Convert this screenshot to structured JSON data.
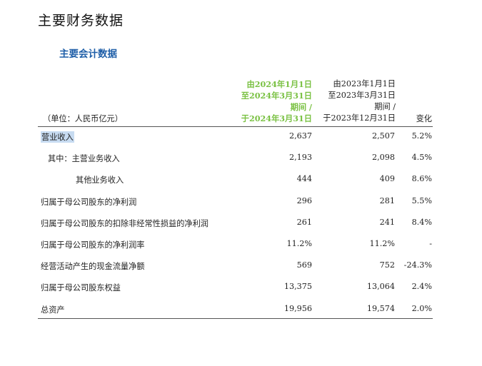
{
  "page_title": "主要财务数据",
  "section_title": "主要会计数据",
  "unit_label": "（单位：人民币亿元）",
  "columns": {
    "current": [
      "由2024年1月1日",
      "至2024年3月31日",
      "期间 /",
      "于2024年3月31日"
    ],
    "prior": [
      "由2023年1月1日",
      "至2023年3月31日",
      "期间 /",
      "于2023年12月31日"
    ],
    "change": "变化"
  },
  "rows": [
    {
      "label": "营业收入",
      "current": "2,637",
      "prior": "2,507",
      "change": "5.2%"
    },
    {
      "label": "其中：主营业务收入",
      "current": "2,193",
      "prior": "2,098",
      "change": "4.5%"
    },
    {
      "label": "其他业务收入",
      "current": "444",
      "prior": "409",
      "change": "8.6%"
    },
    {
      "label": "归属于母公司股东的净利润",
      "current": "296",
      "prior": "281",
      "change": "5.5%"
    },
    {
      "label": "归属于母公司股东的扣除非经常性损益的净利润",
      "current": "261",
      "prior": "241",
      "change": "8.4%"
    },
    {
      "label": "归属于母公司股东的净利润率",
      "current": "11.2%",
      "prior": "11.2%",
      "change": "-"
    },
    {
      "label": "经营活动产生的现金流量净额",
      "current": "569",
      "prior": "752",
      "change": "-24.3%"
    },
    {
      "label": "归属于母公司股东权益",
      "current": "13,375",
      "prior": "13,064",
      "change": "2.4%"
    },
    {
      "label": "总资产",
      "current": "19,956",
      "prior": "19,574",
      "change": "2.0%"
    }
  ],
  "colors": {
    "section_title": "#1e5ea8",
    "current_header": "#7ac143",
    "selection_highlight": "#c7dbf1"
  }
}
